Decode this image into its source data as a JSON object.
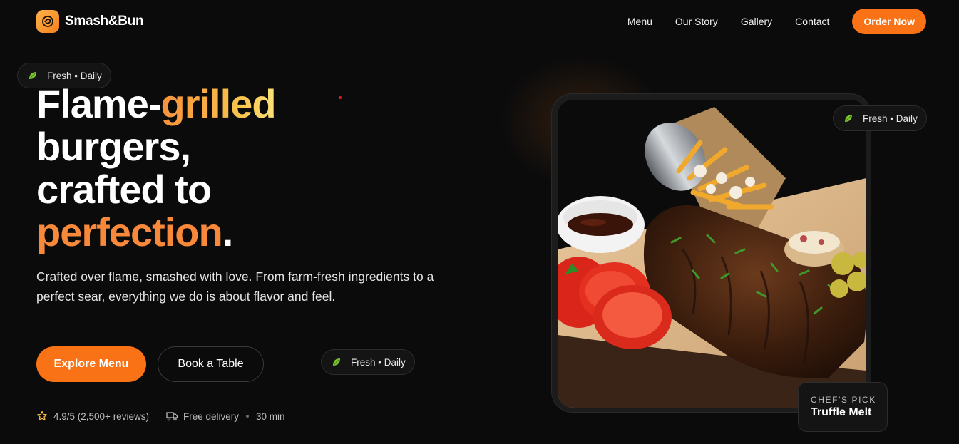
{
  "brand": {
    "name": "Smash&Bun"
  },
  "nav": {
    "links": [
      "Menu",
      "Our Story",
      "Gallery",
      "Contact"
    ],
    "cta": "Order Now"
  },
  "badge": {
    "label": "Fresh • Daily",
    "icon": "leaf-icon"
  },
  "hero": {
    "line1_a": "Flame-",
    "line1_b": "grilled",
    "line2": "burgers,",
    "line3": "crafted to",
    "line4_a": "perfection",
    "line4_b": ".",
    "lede": "Crafted over flame, smashed with love. From farm-fresh ingredients to a perfect sear, everything we do is about flavor and feel.",
    "primary_cta": "Explore Menu",
    "secondary_cta": "Book a Table"
  },
  "stats": {
    "rating": "4.9/5 (2,500+ reviews)",
    "delivery": "Free delivery",
    "time": "30 min"
  },
  "feature": {
    "kicker": "CHEF'S PICK",
    "title": "Truffle Melt"
  },
  "colors": {
    "accent": "#f97316",
    "background": "#0b0b0c"
  }
}
